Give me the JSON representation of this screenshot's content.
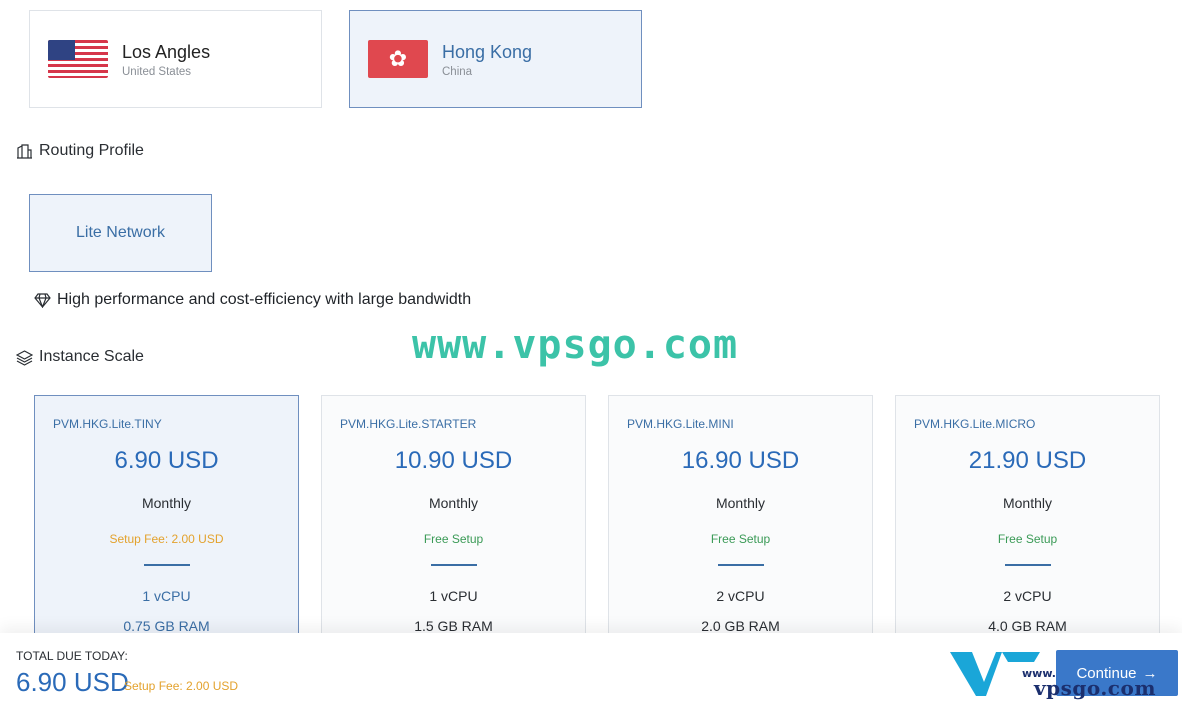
{
  "locations": [
    {
      "name": "Los Angles",
      "country": "United States",
      "selected": false
    },
    {
      "name": "Hong Kong",
      "country": "China",
      "selected": true
    }
  ],
  "routing": {
    "title": "Routing Profile",
    "option": "Lite Network",
    "description": "High performance and cost-efficiency with large bandwidth"
  },
  "watermark": "www.vpsgo.com",
  "scale": {
    "title": "Instance Scale",
    "plans": [
      {
        "name": "PVM.HKG.Lite.TINY",
        "price": "6.90 USD",
        "cycle": "Monthly",
        "setup": "Setup Fee: 2.00 USD",
        "cpu": "1 vCPU",
        "ram": "0.75 GB RAM"
      },
      {
        "name": "PVM.HKG.Lite.STARTER",
        "price": "10.90 USD",
        "cycle": "Monthly",
        "setup": "Free Setup",
        "cpu": "1 vCPU",
        "ram": "1.5 GB RAM"
      },
      {
        "name": "PVM.HKG.Lite.MINI",
        "price": "16.90 USD",
        "cycle": "Monthly",
        "setup": "Free Setup",
        "cpu": "2 vCPU",
        "ram": "2.0 GB RAM"
      },
      {
        "name": "PVM.HKG.Lite.MICRO",
        "price": "21.90 USD",
        "cycle": "Monthly",
        "setup": "Free Setup",
        "cpu": "2 vCPU",
        "ram": "4.0 GB RAM"
      }
    ]
  },
  "footer": {
    "total_label": "TOTAL DUE TODAY:",
    "total_amount": "6.90 USD",
    "setup_fee": "Setup Fee: 2.00 USD",
    "continue_label": "Continue",
    "logo_top": "www.",
    "logo_main": "vpsgo.com"
  },
  "icons": {
    "flag_us": "us-flag-icon",
    "flag_hk": "hk-flag-icon",
    "routing": "building-icon",
    "description": "diamond-icon",
    "scale": "layers-icon",
    "continue": "arrow-right-icon"
  },
  "colors": {
    "accent": "#2a6ab8",
    "selected_bg": "#eef3fa",
    "fee": "#e3a22d",
    "free": "#3a9a56",
    "button": "#3a78c9",
    "watermark": "#3cc3a8"
  }
}
